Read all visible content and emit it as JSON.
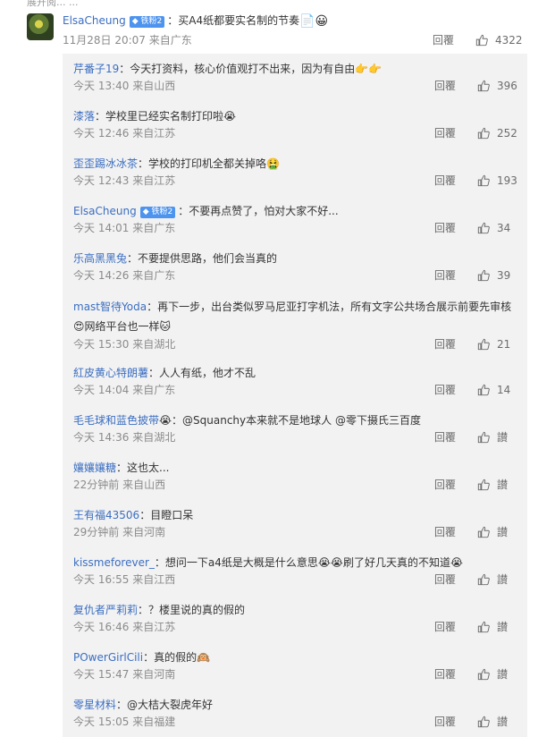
{
  "top_fragment": "展开阅...  ...",
  "main_comment": {
    "username": "ElsaCheung",
    "badge": "◆ 铁粉2",
    "text": "：买A4纸都要实名制的节奏",
    "emojis": "📄😀",
    "meta": "11月28日 20:07 来自广东",
    "reply": "回覆",
    "likes": "4322"
  },
  "replies": [
    {
      "username": "芹番子19",
      "text": "：今天打资料，核心价值观打不出来，因为有自由👉👉",
      "meta": "今天 13:40 来自山西",
      "reply": "回覆",
      "likes": "396"
    },
    {
      "username": "漆落",
      "text": "：学校里已经实名制打印啦😭",
      "meta": "今天 12:46 来自江苏",
      "reply": "回覆",
      "likes": "252"
    },
    {
      "username": "歪歪踢冰冰茶",
      "text": "：学校的打印机全都关掉咯🤮",
      "meta": "今天 12:43 来自江苏",
      "reply": "回覆",
      "likes": "193"
    },
    {
      "username": "ElsaCheung",
      "badge": "◆ 铁粉2",
      "text": "：不要再点赞了，怕对大家不好...",
      "meta": "今天 14:01 来自广东",
      "reply": "回覆",
      "likes": "34"
    },
    {
      "username": "乐高黑黑兔",
      "text": "：不要提供思路，他们会当真的",
      "meta": "今天 14:26 来自广东",
      "reply": "回覆",
      "likes": "39"
    },
    {
      "username": "mast智待Yoda",
      "text": "：再下一步，出台类似罗马尼亚打字机法，所有文字公共场合展示前要先审核😍网络平台也一样🐱",
      "meta": "今天 15:30 来自湖北",
      "reply": "回覆",
      "likes": "21"
    },
    {
      "username": "紅皮黄心特朗薯",
      "text": "：人人有纸，他才不乱",
      "meta": "今天 14:04 来自广东",
      "reply": "回覆",
      "likes": "14"
    },
    {
      "username": "毛毛球和蓝色披带",
      "text": "😭：@Squanchy本来就不是地球人 @零下摄氏三百度",
      "meta": "今天 14:36 来自湖北",
      "reply": "回覆",
      "likes": "讃"
    },
    {
      "username": "孃孃孃糖",
      "text": "：这也太...",
      "meta": "22分钟前 来自山西",
      "reply": "回覆",
      "likes": "讃"
    },
    {
      "username": "王有福43506",
      "text": "：目瞪口呆",
      "meta": "29分钟前 来自河南",
      "reply": "回覆",
      "likes": "讃"
    },
    {
      "username": "kissmeforever_",
      "text": "：想问一下a4纸是大概是什么意思😭😭刷了好几天真的不知道😭",
      "meta": "今天 16:55 来自江西",
      "reply": "回覆",
      "likes": "讃"
    },
    {
      "username": "复仇者严莉莉",
      "text": "：？楼里说的真的假的",
      "meta": "今天 16:46 来自江苏",
      "reply": "回覆",
      "likes": "讃"
    },
    {
      "username": "POwerGirlCili",
      "text": "：真的假的🙉",
      "meta": "今天 15:47 来自河南",
      "reply": "回覆",
      "likes": "讃"
    },
    {
      "username": "零星材料",
      "text": "：@大桔大裂虎年好",
      "meta": "今天 15:05 来自福建",
      "reply": "回覆",
      "likes": "讃"
    }
  ]
}
